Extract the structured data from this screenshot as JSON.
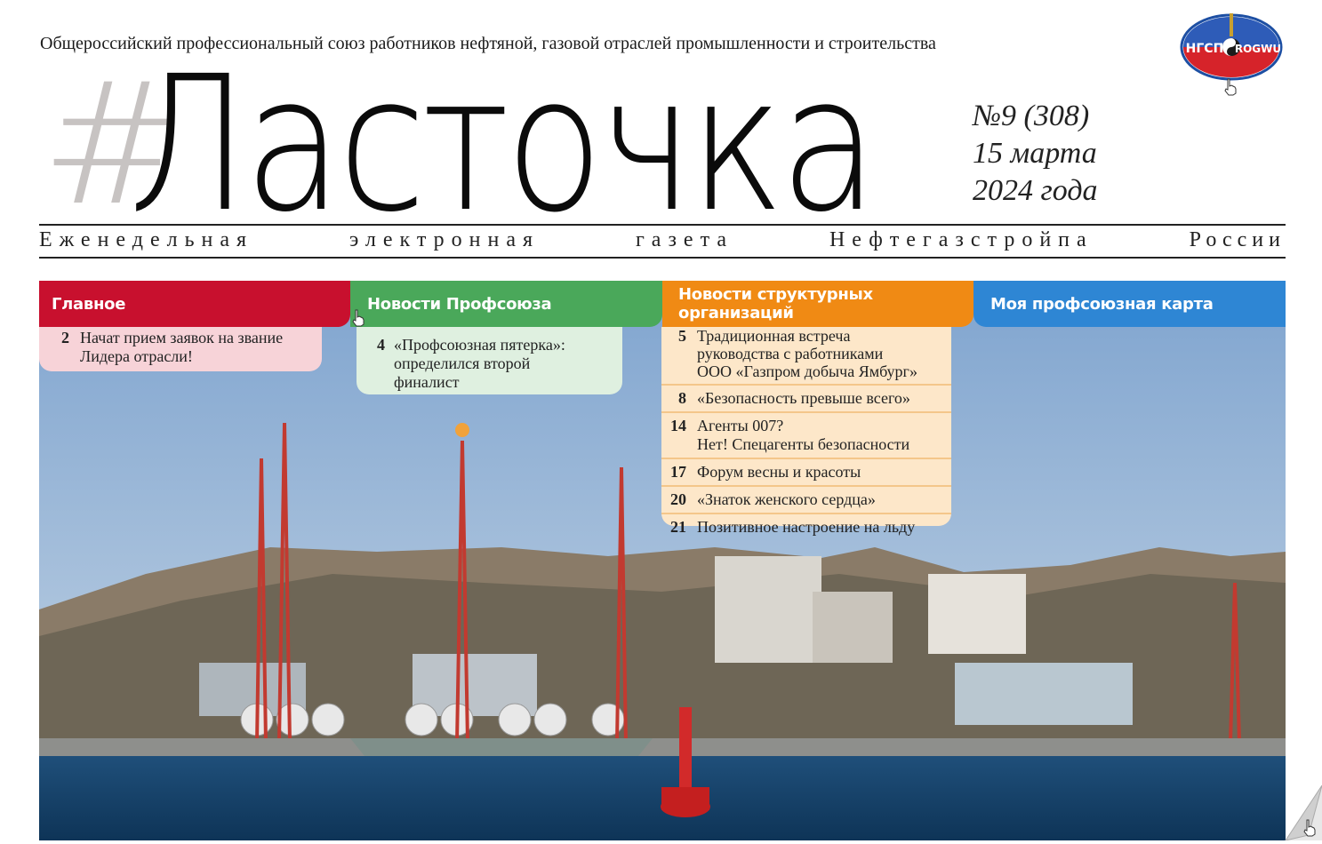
{
  "header": {
    "union_name": "Общероссийский профессиональный союз работников нефтяной, газовой отраслей промышленности и строительства",
    "logo_text_left": "НГСП",
    "logo_text_right": "ROGWU",
    "hash": "#",
    "title": "Ласточка",
    "issue_number": "№9 (308)",
    "issue_date_line1": "15 марта",
    "issue_date_line2": "2024 года",
    "tagline_words": [
      "Еженедельная",
      "электронная",
      "газета",
      "Нефтегазстройпа",
      "России"
    ]
  },
  "colors": {
    "red": "#c8102e",
    "green": "#4aa85a",
    "orange": "#f08a14",
    "blue": "#2e86d4",
    "red_panel": "#f7d3d8",
    "green_panel": "#dff0e0",
    "orange_panel": "#fde7c9"
  },
  "tabs": [
    {
      "label": "Главное"
    },
    {
      "label": "Новости Профсоюза"
    },
    {
      "label": "Новости структурных организаций"
    },
    {
      "label": "Моя профсоюзная карта"
    }
  ],
  "main_items": [
    {
      "num": "2",
      "line1": "Начат прием заявок на звание",
      "line2": "Лидера отрасли!"
    }
  ],
  "union_news_items": [
    {
      "num": "4",
      "line1": "«Профсоюзная пятерка»:",
      "line2": "определился второй",
      "line3": "финалист"
    }
  ],
  "org_news_items": [
    {
      "num": "5",
      "line1": "Традиционная встреча",
      "line2": "руководства с работниками",
      "line3": "ООО «Газпром добыча Ямбург»"
    },
    {
      "num": "8",
      "line1": "«Безопасность превыше всего»"
    },
    {
      "num": "14",
      "line1": "Агенты 007?",
      "line2": "Нет! Спецагенты безопасности"
    },
    {
      "num": "17",
      "line1": "Форум весны и красоты"
    },
    {
      "num": "20",
      "line1": "«Знаток женского сердца»"
    },
    {
      "num": "21",
      "line1": "Позитивное настроение на льду"
    }
  ]
}
